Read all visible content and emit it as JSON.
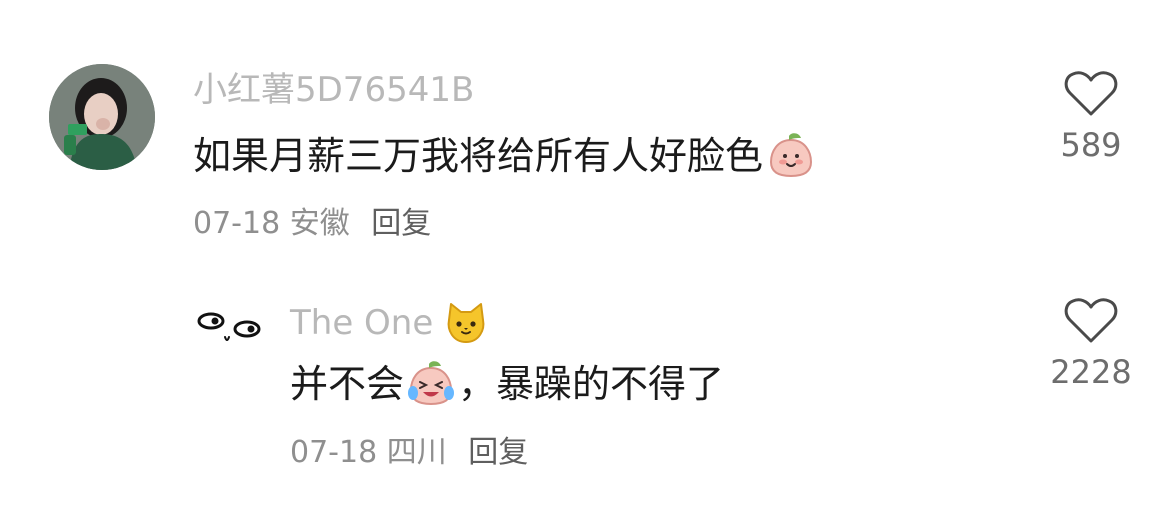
{
  "comments": [
    {
      "username": "小红薯5D76541B",
      "text": "如果月薪三万我将给所有人好脸色",
      "date": "07-18",
      "location": "安徽",
      "reply_label": "回复",
      "likes": "589",
      "avatar_icon": "woman-avatar",
      "text_emoji_icon": "peach-smile-emoji"
    },
    {
      "username": "The One",
      "username_emoji_icon": "cat-face-emoji",
      "text_before_emoji": "并不会",
      "text_after_emoji": "，暴躁的不得了",
      "date": "07-18",
      "location": "四川",
      "reply_label": "回复",
      "likes": "2228",
      "avatar_icon": "eyes-doodle-avatar",
      "text_emoji_icon": "peach-crying-laughing-emoji"
    }
  ],
  "colors": {
    "username": "#b8b8b8",
    "text": "#1b1b1b",
    "meta": "#8f8f8f",
    "like_count": "#6d6d6d"
  }
}
